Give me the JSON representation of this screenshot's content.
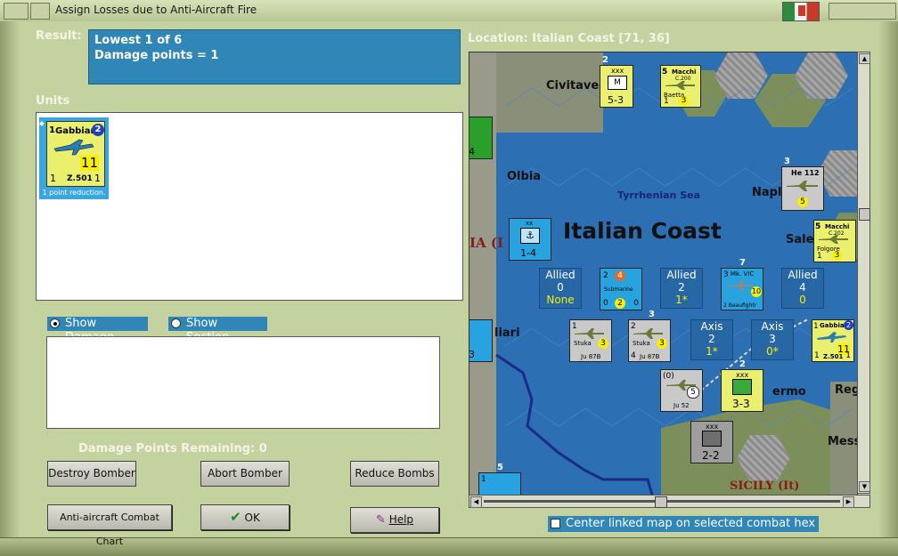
{
  "window": {
    "title": "Assign Losses due to Anti-Aircraft Fire"
  },
  "result": {
    "label": "Result:",
    "lines": [
      "Lowest 1 of 6",
      "Damage points = 1"
    ]
  },
  "units": {
    "label": "Units",
    "items": [
      {
        "strength_top": "1",
        "name": "Gabbiano",
        "badge": "2",
        "value": "11",
        "left": "1",
        "type": "Z.501",
        "right": "1",
        "caption": "1 point reduction."
      }
    ]
  },
  "options": {
    "show_damage": "Show Damage",
    "show_section": "Show Section"
  },
  "damage_points": {
    "text": "Damage Points Remaining:  0"
  },
  "buttons": {
    "destroy": "Destroy Bomber",
    "abort": "Abort Bomber",
    "reduce": "Reduce Bombs",
    "chart": "Anti-aircraft Combat Chart",
    "ok": "OK",
    "help": "Help"
  },
  "location": {
    "text": "Location:  Italian Coast [71, 36]"
  },
  "map": {
    "title": "Italian Coast",
    "labels": {
      "civitavecchia": "Civitave",
      "olbia": "Olbia",
      "tyrrhenian": "Tyrrhenian Sea",
      "napoli": "Napl",
      "salerno": "Sale",
      "cagliari": "liari",
      "palermo": "ermo",
      "reggio": "Reg",
      "messina": "Mess",
      "sicily": "SICILY (It)",
      "sardinia": "IA (I"
    },
    "info": [
      {
        "label": "Allied",
        "value": "0",
        "extra": "None"
      },
      {
        "label": "Allied",
        "value": "2",
        "extra": "1*"
      },
      {
        "label": "Allied",
        "value": "4",
        "extra": "0"
      },
      {
        "label": "Axis",
        "value": "2",
        "extra": "1*"
      },
      {
        "label": "Axis",
        "value": "3",
        "extra": "0*"
      }
    ],
    "counters": {
      "macchi_top": {
        "top": "5",
        "name": "Macchi",
        "sub": "C.200",
        "unit": "Baetta",
        "left": "1",
        "val": "3"
      },
      "inf_top": {
        "top": "2",
        "size": "xxx",
        "stat": "5-3"
      },
      "he112": {
        "top": "3",
        "name": "He 112",
        "val": "5"
      },
      "macchi_right": {
        "top": "5",
        "name": "Macchi",
        "sub": "C.202",
        "unit": "Folgore",
        "left": "1",
        "val": "3"
      },
      "naval": {
        "size": "xx",
        "stat": "1-4"
      },
      "sub": {
        "v1": "2",
        "v2": "4",
        "name": "Submarine",
        "v3": "0",
        "v4": "2",
        "v5": "0"
      },
      "beaufighter": {
        "top": "7",
        "name": "Mk. VIC",
        "left": "3",
        "val": "10",
        "type": "2 Beaufightr"
      },
      "stuka1": {
        "top": "",
        "left": "1",
        "name": "Stuka",
        "val": "3",
        "type": "Ju 87B"
      },
      "stuka2": {
        "top": "3",
        "left": "2",
        "name": "Stuka",
        "val": "3",
        "type": "Ju 87B",
        "bl": "4"
      },
      "ju52": {
        "top": "(0)",
        "val": "5",
        "type": "Ju 52"
      },
      "inf_mid": {
        "top": "2",
        "size": "xxx",
        "stat": "3-3"
      },
      "gabbiano_map": {
        "top": "1",
        "name": "Gabbiano",
        "badge": "2",
        "val": "11",
        "left": "1",
        "type": "Z.501",
        "right": "1"
      },
      "inf_bot": {
        "size": "xxx",
        "stat": "2-2"
      },
      "bottom_left": {
        "top": "5",
        "val": "1"
      },
      "left_green": {
        "stat": "-4"
      },
      "left_blue": {
        "stat": "-3"
      }
    }
  },
  "checkbox": {
    "label": "Center linked map on selected combat hex"
  }
}
